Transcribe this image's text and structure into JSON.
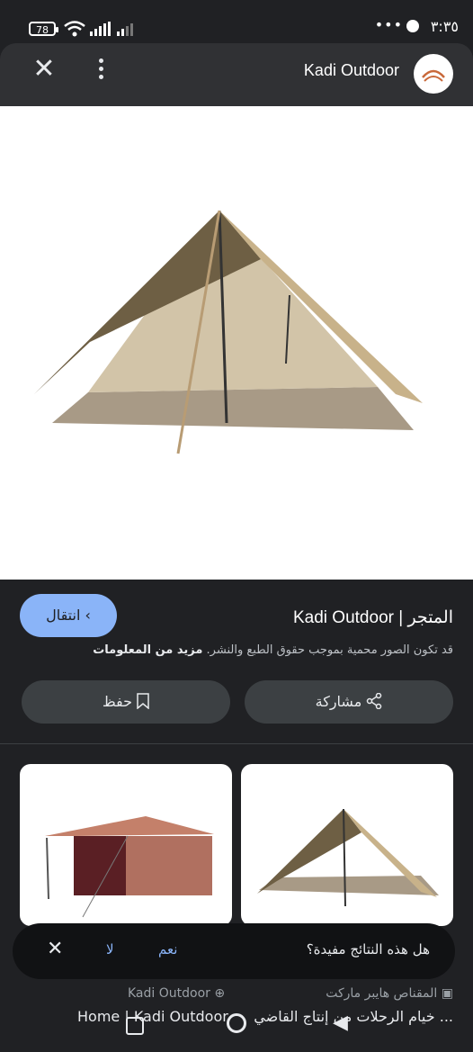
{
  "status_bar": {
    "time": "٣:٣٥",
    "battery": "78",
    "dots": "•••"
  },
  "header": {
    "title": "Kadi Outdoor"
  },
  "main": {
    "store_title": "Kadi Outdoor | المتجر",
    "visit_label": "انتقال",
    "copyright": "قد تكون الصور محمية بموجب حقوق الطبع والنشر.",
    "more_info": "مزيد من المعلومات",
    "share_label": "مشاركة",
    "save_label": "حفظ"
  },
  "feedback": {
    "question": "هل هذه النتائج مفيدة؟",
    "yes": "نعم",
    "no": "لا"
  },
  "results": [
    {
      "source": "المقناص هايبر ماركت",
      "title": "خيام الرحلات من إنتاج القاضي ..."
    },
    {
      "source": "Kadi Outdoor",
      "title": "Home | Kadi Outdoor"
    }
  ],
  "colors": {
    "background": "#202124",
    "accent": "#8ab4f8",
    "surface": "#3c4043"
  }
}
